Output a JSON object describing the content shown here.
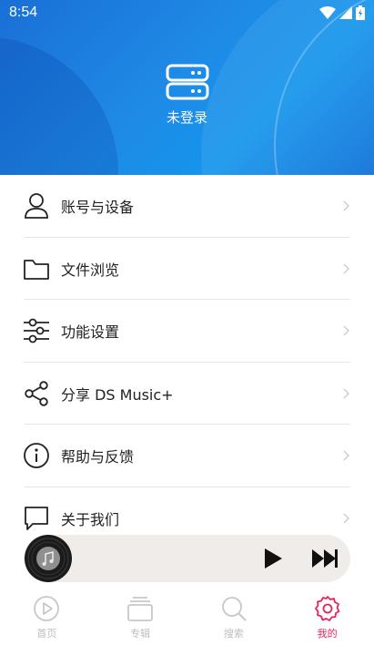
{
  "status_bar": {
    "time": "8:54"
  },
  "header": {
    "login_label": "未登录"
  },
  "menu": {
    "items": [
      {
        "label": "账号与设备",
        "icon": "user-icon"
      },
      {
        "label": "文件浏览",
        "icon": "folder-icon"
      },
      {
        "label": "功能设置",
        "icon": "sliders-icon"
      },
      {
        "label": "分享 DS Music+",
        "icon": "share-icon"
      },
      {
        "label": "帮助与反馈",
        "icon": "info-icon"
      },
      {
        "label": "关于我们",
        "icon": "chat-icon"
      }
    ]
  },
  "bottom_nav": {
    "items": [
      {
        "label": "首页",
        "icon": "play-circle-icon",
        "active": false
      },
      {
        "label": "专辑",
        "icon": "album-stack-icon",
        "active": false
      },
      {
        "label": "搜索",
        "icon": "search-icon",
        "active": false
      },
      {
        "label": "我的",
        "icon": "gear-icon",
        "active": true
      }
    ]
  },
  "colors": {
    "accent": "#e8245a",
    "header_blue": "#1a7fe0",
    "inactive": "#bdbdbd"
  }
}
